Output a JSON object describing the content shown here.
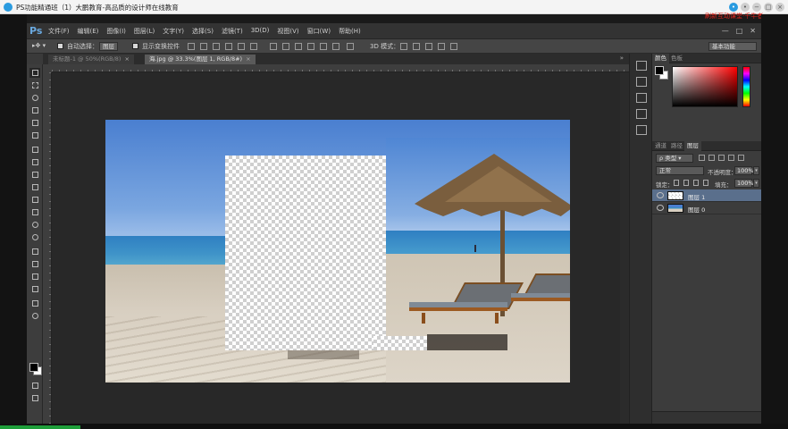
{
  "player": {
    "title": "PS功能精通班（1）大鹏教育-高品质的设计师在线教育",
    "message": "刷新互动课堂·千牛者"
  },
  "app": {
    "logo": "Ps",
    "menus": [
      "文件(F)",
      "编辑(E)",
      "图像(I)",
      "图层(L)",
      "文字(Y)",
      "选择(S)",
      "滤镜(T)",
      "3D(D)",
      "视图(V)",
      "窗口(W)",
      "帮助(H)"
    ],
    "window_controls": [
      "—",
      "□",
      "✕"
    ]
  },
  "options_bar": {
    "auto_select_label": "自动选择：",
    "auto_select_target": "图层",
    "show_transform_label": "显示变换控件",
    "mode_3d_label": "3D 模式："
  },
  "document_tabs": [
    {
      "label": "未标题-1 @ 50%(RGB/8)",
      "active": false
    },
    {
      "label": "海.jpg @ 33.3%(图层 1, RGB/8#)",
      "active": true
    }
  ],
  "workspace": "基本功能",
  "color_panel": {
    "tabs": [
      "颜色",
      "色板"
    ],
    "foreground": "#000000",
    "background": "#ffffff"
  },
  "layers_panel": {
    "tabs": [
      "通道",
      "路径",
      "图层"
    ],
    "kind_label": "类型",
    "blend_mode": "正常",
    "opacity_label": "不透明度：",
    "opacity_value": "100%",
    "lock_label": "锁定：",
    "fill_label": "填充：",
    "fill_value": "100%",
    "layers": [
      {
        "name": "图层 1",
        "selected": true
      },
      {
        "name": "图层 0",
        "selected": false
      }
    ]
  },
  "colors": {
    "accent": "#2a9be0",
    "selection": "#5a6f8c",
    "progress": "#1e9e3a"
  }
}
